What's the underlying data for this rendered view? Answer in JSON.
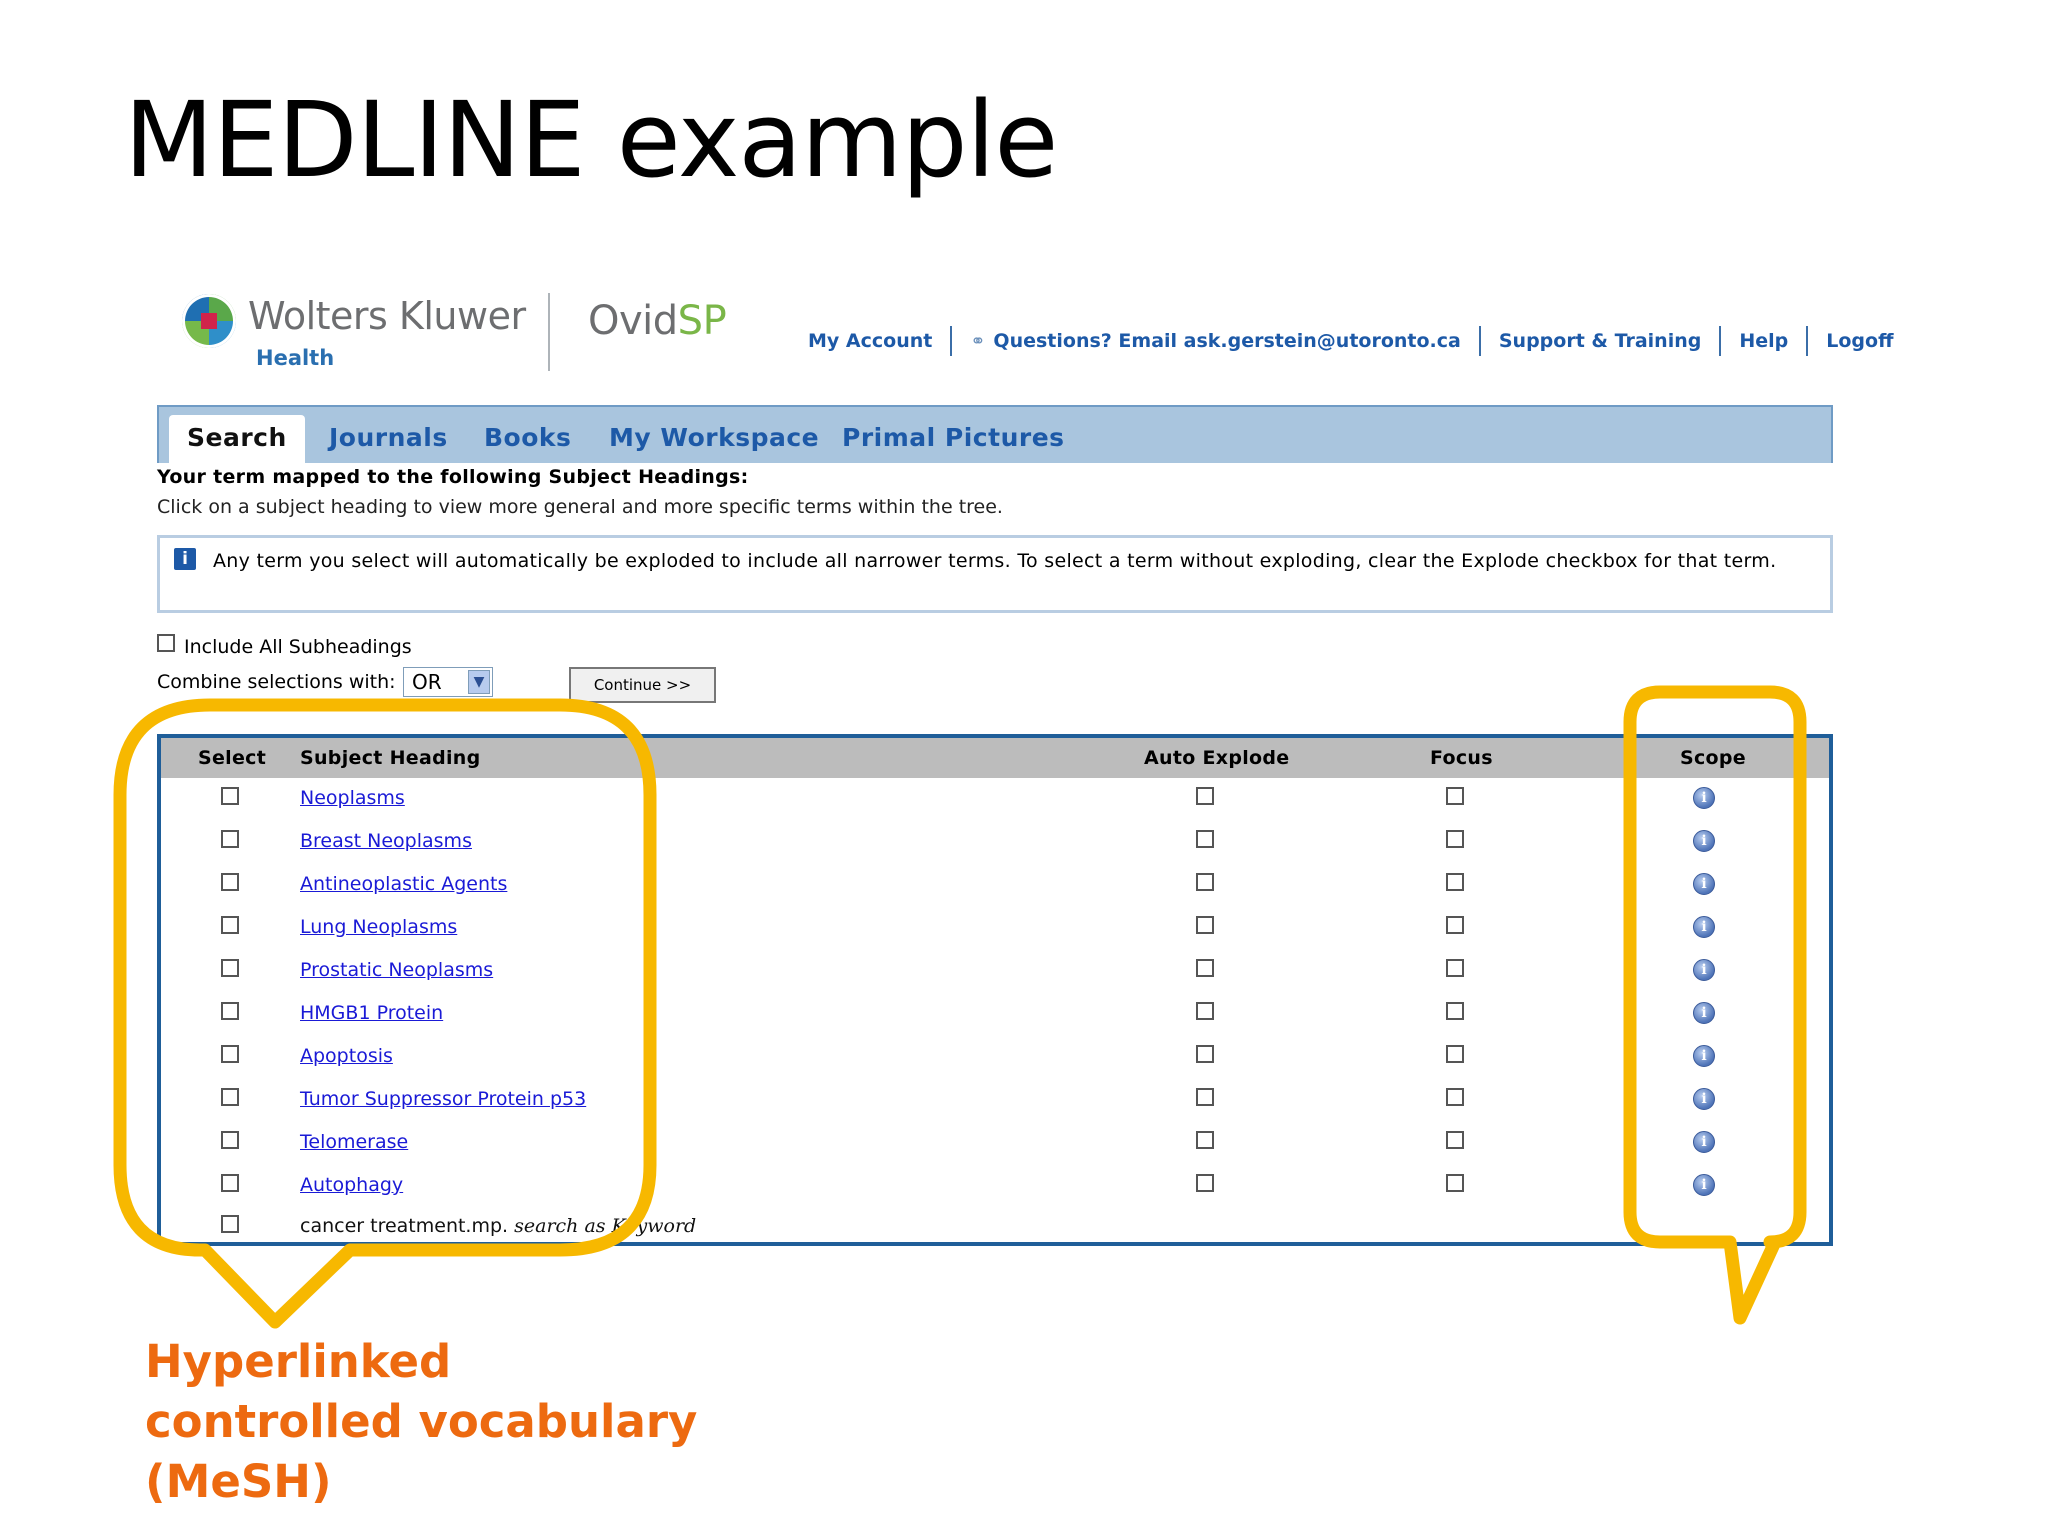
{
  "slide": {
    "title": "MEDLINE example",
    "callout_text": "Hyperlinked controlled vocabulary (MeSH)",
    "callout_color": "#ed6a10",
    "highlight_color": "#f7b800"
  },
  "header": {
    "logo_name": "Wolters Kluwer",
    "logo_sub": "Health",
    "product_prefix": "Ovid",
    "product_suffix": "SP",
    "links": {
      "my_account": "My Account",
      "questions": "Questions? Email ask.gerstein@utoronto.ca",
      "support": "Support & Training",
      "help": "Help",
      "logoff": "Logoff"
    }
  },
  "nav": {
    "tabs": [
      "Search",
      "Journals",
      "Books",
      "My Workspace",
      "Primal Pictures"
    ],
    "active": "Search"
  },
  "info": {
    "mapped": "Your term mapped to the following Subject Headings:",
    "click_hint": "Click on a subject heading to view more general and more specific terms within the tree.",
    "notice": "Any term you select will automatically be exploded to include all narrower terms. To select a term without exploding, clear the Explode checkbox for that term."
  },
  "controls": {
    "include_all": "Include All Subheadings",
    "combine_label": "Combine selections with:",
    "combine_value": "OR",
    "continue_label": "Continue >>"
  },
  "table": {
    "headers": {
      "select": "Select",
      "subject_heading": "Subject Heading",
      "auto_explode": "Auto Explode",
      "focus": "Focus",
      "scope": "Scope"
    },
    "rows": [
      "Neoplasms",
      "Breast Neoplasms",
      "Antineoplastic Agents",
      "Lung Neoplasms",
      "Prostatic Neoplasms",
      "HMGB1 Protein",
      "Apoptosis",
      "Tumor Suppressor Protein p53",
      "Telomerase",
      "Autophagy"
    ],
    "keyword_row": {
      "term": "cancer treatment.mp.",
      "suffix": "search as Keyword"
    }
  }
}
